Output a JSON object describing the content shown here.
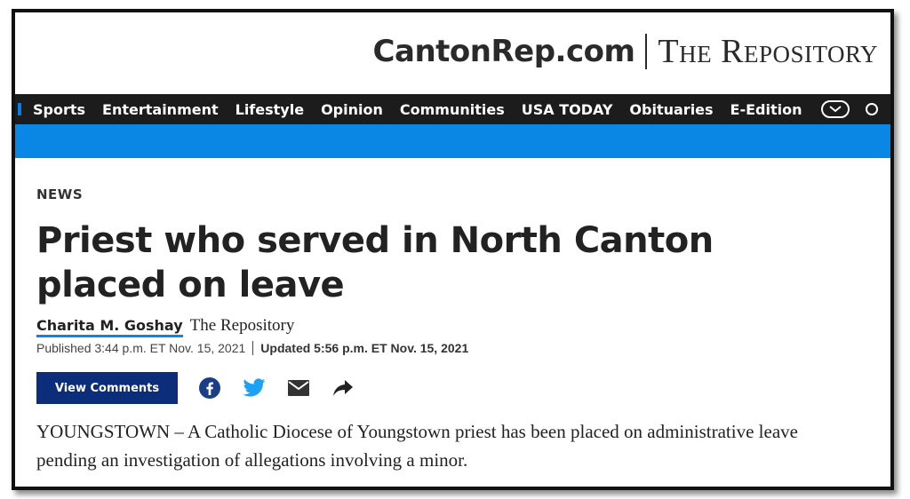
{
  "masthead": {
    "site": "CantonRep.com",
    "paper": "The Repository"
  },
  "nav": {
    "items": [
      "Sports",
      "Entertainment",
      "Lifestyle",
      "Opinion",
      "Communities",
      "USA TODAY",
      "Obituaries",
      "E-Edition"
    ],
    "more_icon": "chevron-down-icon",
    "search_icon": "search-icon"
  },
  "colors": {
    "accent_blue": "#0a86e4",
    "nav_bg": "#1c1c1c",
    "button_navy": "#0b2d7a"
  },
  "article": {
    "section": "NEWS",
    "headline": "Priest who served in North Canton placed on leave",
    "author": "Charita M. Goshay",
    "outlet": "The Repository",
    "published": "Published 3:44 p.m. ET Nov. 15, 2021",
    "updated": "Updated 5:56 p.m. ET Nov. 15, 2021",
    "view_comments": "View Comments",
    "share_icons": [
      "facebook-icon",
      "twitter-icon",
      "email-icon",
      "share-arrow-icon"
    ],
    "lede": "YOUNGSTOWN – A Catholic Diocese of Youngstown priest has been placed on administrative leave pending an investigation of allegations involving a minor."
  }
}
